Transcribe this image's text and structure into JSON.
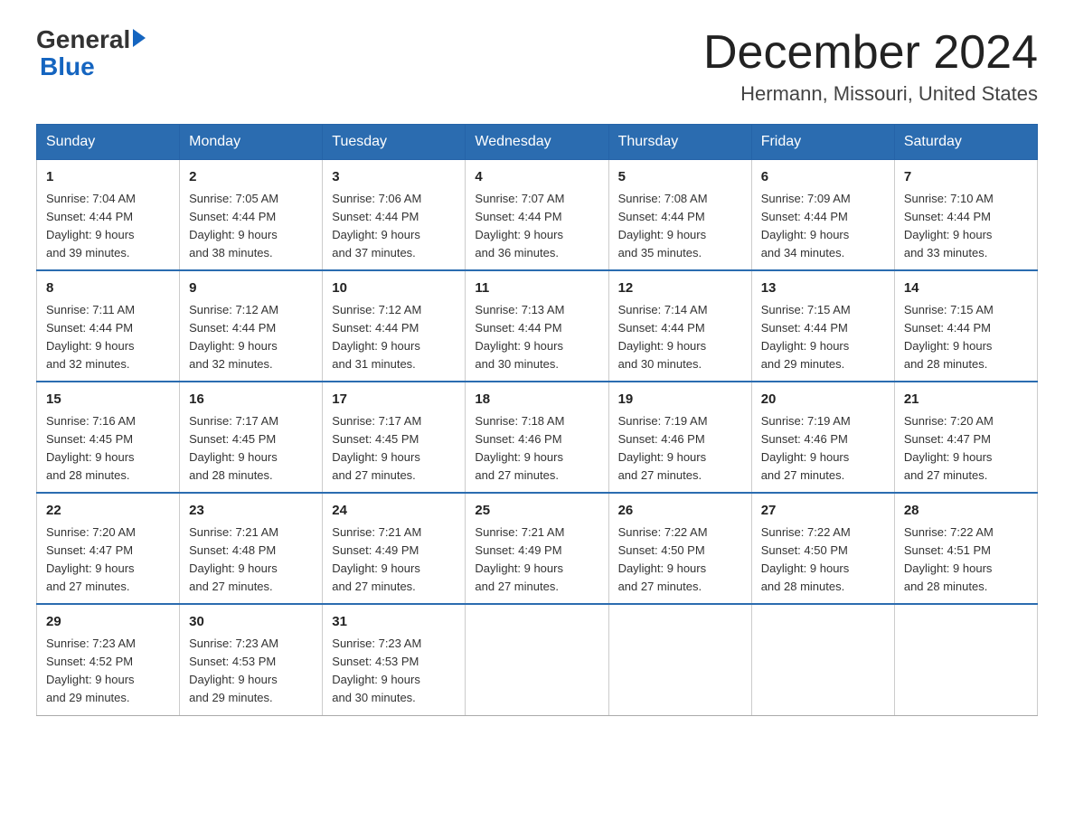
{
  "header": {
    "logo_general": "General",
    "logo_blue": "Blue",
    "month_title": "December 2024",
    "location": "Hermann, Missouri, United States"
  },
  "days_of_week": [
    "Sunday",
    "Monday",
    "Tuesday",
    "Wednesday",
    "Thursday",
    "Friday",
    "Saturday"
  ],
  "weeks": [
    [
      {
        "day": 1,
        "sunrise": "7:04 AM",
        "sunset": "4:44 PM",
        "daylight": "9 hours and 39 minutes."
      },
      {
        "day": 2,
        "sunrise": "7:05 AM",
        "sunset": "4:44 PM",
        "daylight": "9 hours and 38 minutes."
      },
      {
        "day": 3,
        "sunrise": "7:06 AM",
        "sunset": "4:44 PM",
        "daylight": "9 hours and 37 minutes."
      },
      {
        "day": 4,
        "sunrise": "7:07 AM",
        "sunset": "4:44 PM",
        "daylight": "9 hours and 36 minutes."
      },
      {
        "day": 5,
        "sunrise": "7:08 AM",
        "sunset": "4:44 PM",
        "daylight": "9 hours and 35 minutes."
      },
      {
        "day": 6,
        "sunrise": "7:09 AM",
        "sunset": "4:44 PM",
        "daylight": "9 hours and 34 minutes."
      },
      {
        "day": 7,
        "sunrise": "7:10 AM",
        "sunset": "4:44 PM",
        "daylight": "9 hours and 33 minutes."
      }
    ],
    [
      {
        "day": 8,
        "sunrise": "7:11 AM",
        "sunset": "4:44 PM",
        "daylight": "9 hours and 32 minutes."
      },
      {
        "day": 9,
        "sunrise": "7:12 AM",
        "sunset": "4:44 PM",
        "daylight": "9 hours and 32 minutes."
      },
      {
        "day": 10,
        "sunrise": "7:12 AM",
        "sunset": "4:44 PM",
        "daylight": "9 hours and 31 minutes."
      },
      {
        "day": 11,
        "sunrise": "7:13 AM",
        "sunset": "4:44 PM",
        "daylight": "9 hours and 30 minutes."
      },
      {
        "day": 12,
        "sunrise": "7:14 AM",
        "sunset": "4:44 PM",
        "daylight": "9 hours and 30 minutes."
      },
      {
        "day": 13,
        "sunrise": "7:15 AM",
        "sunset": "4:44 PM",
        "daylight": "9 hours and 29 minutes."
      },
      {
        "day": 14,
        "sunrise": "7:15 AM",
        "sunset": "4:44 PM",
        "daylight": "9 hours and 28 minutes."
      }
    ],
    [
      {
        "day": 15,
        "sunrise": "7:16 AM",
        "sunset": "4:45 PM",
        "daylight": "9 hours and 28 minutes."
      },
      {
        "day": 16,
        "sunrise": "7:17 AM",
        "sunset": "4:45 PM",
        "daylight": "9 hours and 28 minutes."
      },
      {
        "day": 17,
        "sunrise": "7:17 AM",
        "sunset": "4:45 PM",
        "daylight": "9 hours and 27 minutes."
      },
      {
        "day": 18,
        "sunrise": "7:18 AM",
        "sunset": "4:46 PM",
        "daylight": "9 hours and 27 minutes."
      },
      {
        "day": 19,
        "sunrise": "7:19 AM",
        "sunset": "4:46 PM",
        "daylight": "9 hours and 27 minutes."
      },
      {
        "day": 20,
        "sunrise": "7:19 AM",
        "sunset": "4:46 PM",
        "daylight": "9 hours and 27 minutes."
      },
      {
        "day": 21,
        "sunrise": "7:20 AM",
        "sunset": "4:47 PM",
        "daylight": "9 hours and 27 minutes."
      }
    ],
    [
      {
        "day": 22,
        "sunrise": "7:20 AM",
        "sunset": "4:47 PM",
        "daylight": "9 hours and 27 minutes."
      },
      {
        "day": 23,
        "sunrise": "7:21 AM",
        "sunset": "4:48 PM",
        "daylight": "9 hours and 27 minutes."
      },
      {
        "day": 24,
        "sunrise": "7:21 AM",
        "sunset": "4:49 PM",
        "daylight": "9 hours and 27 minutes."
      },
      {
        "day": 25,
        "sunrise": "7:21 AM",
        "sunset": "4:49 PM",
        "daylight": "9 hours and 27 minutes."
      },
      {
        "day": 26,
        "sunrise": "7:22 AM",
        "sunset": "4:50 PM",
        "daylight": "9 hours and 27 minutes."
      },
      {
        "day": 27,
        "sunrise": "7:22 AM",
        "sunset": "4:50 PM",
        "daylight": "9 hours and 28 minutes."
      },
      {
        "day": 28,
        "sunrise": "7:22 AM",
        "sunset": "4:51 PM",
        "daylight": "9 hours and 28 minutes."
      }
    ],
    [
      {
        "day": 29,
        "sunrise": "7:23 AM",
        "sunset": "4:52 PM",
        "daylight": "9 hours and 29 minutes."
      },
      {
        "day": 30,
        "sunrise": "7:23 AM",
        "sunset": "4:53 PM",
        "daylight": "9 hours and 29 minutes."
      },
      {
        "day": 31,
        "sunrise": "7:23 AM",
        "sunset": "4:53 PM",
        "daylight": "9 hours and 30 minutes."
      },
      null,
      null,
      null,
      null
    ]
  ],
  "labels": {
    "sunrise": "Sunrise:",
    "sunset": "Sunset:",
    "daylight": "Daylight:"
  },
  "colors": {
    "header_bg": "#2B6CB0",
    "header_text": "#ffffff",
    "border": "#aaaaaa"
  }
}
